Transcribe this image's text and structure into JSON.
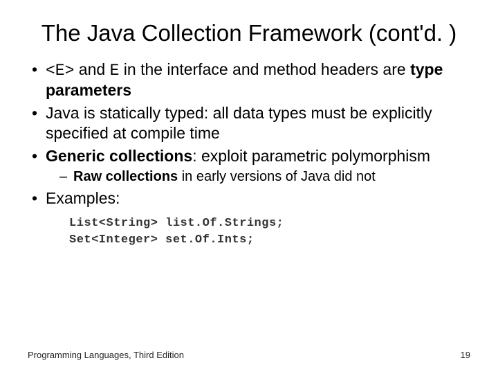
{
  "title": "The Java Collection Framework (cont'd. )",
  "bullets": {
    "b1_pre": "<E>",
    "b1_mid": " and ",
    "b1_code2": "E",
    "b1_post": " in the interface and method headers are ",
    "b1_bold": "type parameters",
    "b2": "Java is statically typed: all data types must be explicitly specified at compile time",
    "b3_bold": "Generic collections",
    "b3_post": ": exploit parametric polymorphism",
    "b3_sub_bold": "Raw collections",
    "b3_sub_post": " in early versions of Java did not",
    "b4": "Examples:"
  },
  "code": {
    "l1": "List<String> list.Of.Strings;",
    "l2": "Set<Integer> set.Of.Ints;"
  },
  "footer": {
    "left": "Programming Languages, Third Edition",
    "right": "19"
  }
}
